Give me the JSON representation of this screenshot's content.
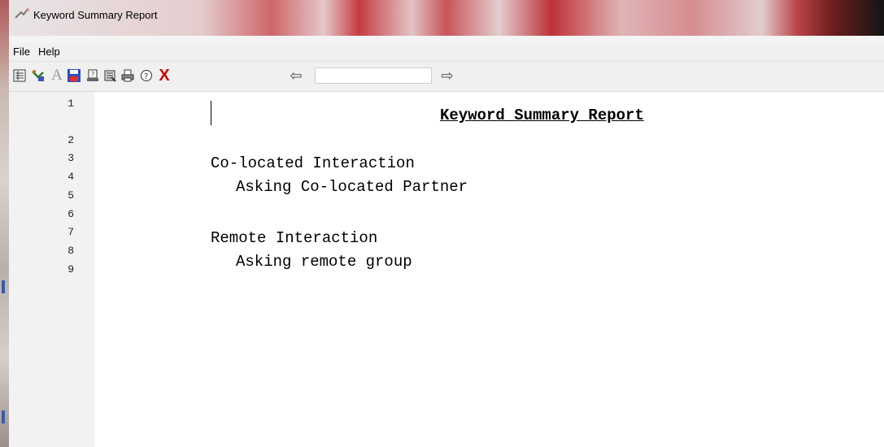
{
  "window": {
    "title": "Keyword Summary Report"
  },
  "menu": [
    {
      "label": "File"
    },
    {
      "label": "Help"
    }
  ],
  "toolbar": {
    "icons": [
      {
        "name": "list-view-icon",
        "glyph": "▤"
      },
      {
        "name": "keyword-icon",
        "glyph": "✎"
      },
      {
        "name": "font-icon",
        "glyph": "A"
      },
      {
        "name": "save-icon",
        "glyph": "▬"
      },
      {
        "name": "report-icon",
        "glyph": "▣"
      },
      {
        "name": "notes-icon",
        "glyph": "▥"
      },
      {
        "name": "print-icon",
        "glyph": "⎙"
      },
      {
        "name": "help-icon",
        "glyph": "?"
      },
      {
        "name": "close-icon",
        "glyph": "X"
      }
    ],
    "search_value": "",
    "prev_glyph": "⇦",
    "next_glyph": "⇨"
  },
  "colors": {
    "close": "#cc0000",
    "save": "#2b4fbf",
    "font": "#9a9a9a"
  },
  "document": {
    "line_numbers": [
      "1",
      "2",
      "3",
      "4",
      "5",
      "6",
      "7",
      "8",
      "9"
    ],
    "title": "Keyword Summary Report",
    "groups": [
      {
        "heading": "Co-located Interaction",
        "items": [
          "Asking Co-located Partner"
        ]
      },
      {
        "heading": "Remote Interaction",
        "items": [
          "Asking remote group"
        ]
      }
    ]
  }
}
